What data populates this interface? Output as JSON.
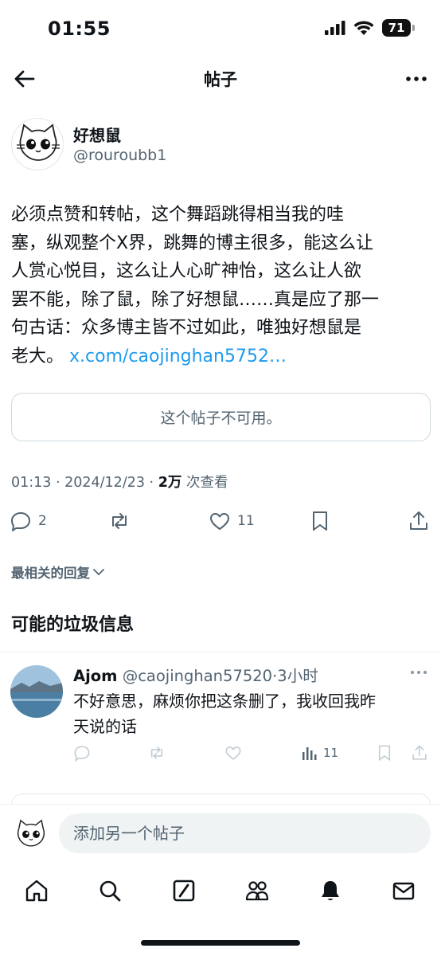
{
  "status_bar": {
    "time": "01:55",
    "battery": "71"
  },
  "header": {
    "title": "帖子"
  },
  "post": {
    "author_name": "好想鼠",
    "author_handle": "@rouroubb1",
    "text_lines": [
      "必须点赞和转帖，这个舞蹈跳得相当我的哇",
      "塞，纵观整个X界，跳舞的博主很多，能这么让",
      "人赏心悦目，这么让人心旷神怡，这么让人欲",
      "罢不能，除了鼠，除了好想鼠……真是应了那一",
      "句古话：众多博主皆不过如此，唯独好想鼠是"
    ],
    "last_line_text": "老大。",
    "link": "x.com/caojinghan5752…",
    "unavailable_notice": "这个帖子不可用。",
    "timestamp": "01:13 · 2024/12/23 · ",
    "views_count": "2万",
    "views_label": " 次查看",
    "replies": "2",
    "likes": "11"
  },
  "sort_label": "最相关的回复",
  "spam_section_title": "可能的垃圾信息",
  "reply": {
    "name": "Ajom",
    "handle": "@caojinghan57520",
    "time": "3小时",
    "text_lines": [
      "不好意思，麻烦你把这条删了，我收回我昨",
      "天说的话"
    ],
    "views": "11"
  },
  "composer": {
    "placeholder": "添加另一个帖子"
  },
  "icons": {
    "back": "arrow-left-icon",
    "more": "more-horizontal-icon",
    "reply": "comment-icon",
    "repost": "repost-icon",
    "like": "heart-icon",
    "bookmark": "bookmark-icon",
    "share": "share-icon",
    "analytics": "bar-chart-icon",
    "home": "home-icon",
    "search": "search-icon",
    "grok": "grok-icon",
    "communities": "people-icon",
    "notifications": "bell-icon",
    "messages": "mail-icon"
  },
  "colors": {
    "link": "#1d9bf0",
    "secondary_text": "#536471",
    "text": "#0f1419"
  }
}
